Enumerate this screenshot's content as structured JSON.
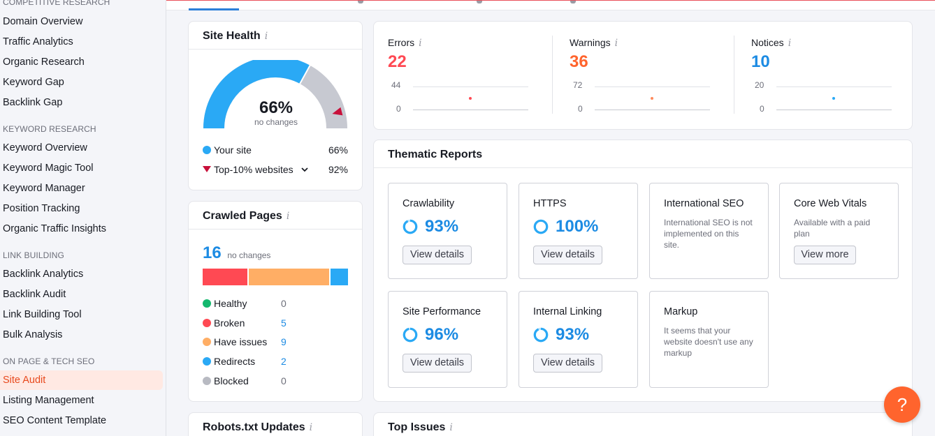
{
  "sidebar": {
    "sections": [
      {
        "label": "COMPETITIVE RESEARCH",
        "items": [
          "Domain Overview",
          "Traffic Analytics",
          "Organic Research",
          "Keyword Gap",
          "Backlink Gap"
        ]
      },
      {
        "label": "KEYWORD RESEARCH",
        "items": [
          "Keyword Overview",
          "Keyword Magic Tool",
          "Keyword Manager",
          "Position Tracking",
          "Organic Traffic Insights"
        ]
      },
      {
        "label": "LINK BUILDING",
        "items": [
          "Backlink Analytics",
          "Backlink Audit",
          "Link Building Tool",
          "Bulk Analysis"
        ]
      },
      {
        "label": "ON PAGE & TECH SEO",
        "items": [
          "Site Audit",
          "Listing Management",
          "SEO Content Template"
        ]
      }
    ],
    "active_item": "Site Audit"
  },
  "site_health": {
    "title": "Site Health",
    "info": "i",
    "percent": "66%",
    "percent_value": 66,
    "top10_marker_value": 92,
    "sub": "no changes",
    "legend": [
      {
        "label": "Your site",
        "value": "66%",
        "color": "#2aa9f5"
      },
      {
        "label": "Top-10% websites",
        "value": "92%",
        "color": "#c8103a"
      }
    ]
  },
  "crawled_pages": {
    "title": "Crawled Pages",
    "info": "i",
    "count": "16",
    "sub": "no changes",
    "rows": [
      {
        "label": "Healthy",
        "value": "0",
        "color": "#14b86e",
        "count": 0
      },
      {
        "label": "Broken",
        "value": "5",
        "color": "#ff4953",
        "count": 5
      },
      {
        "label": "Have issues",
        "value": "9",
        "color": "#ffae65",
        "count": 9
      },
      {
        "label": "Redirects",
        "value": "2",
        "color": "#2aa9f5",
        "count": 2
      },
      {
        "label": "Blocked",
        "value": "0",
        "color": "#b8bac2",
        "count": 0
      }
    ]
  },
  "issues": [
    {
      "label": "Errors",
      "info": "i",
      "value": "22",
      "color": "#ff4953",
      "tick_top": "44",
      "tick_bottom": "0"
    },
    {
      "label": "Warnings",
      "info": "i",
      "value": "36",
      "color": "#ff642d",
      "tick_top": "72",
      "tick_bottom": "0"
    },
    {
      "label": "Notices",
      "info": "i",
      "value": "10",
      "color": "#1c8be3",
      "tick_top": "20",
      "tick_bottom": "0"
    }
  ],
  "thematic": {
    "title": "Thematic Reports",
    "tiles": [
      {
        "title": "Crawlability",
        "pct": "93%",
        "value": 93,
        "button": "View details"
      },
      {
        "title": "HTTPS",
        "pct": "100%",
        "value": 100,
        "button": "View details"
      },
      {
        "title": "International SEO",
        "note": "International SEO is not implemented on this site."
      },
      {
        "title": "Core Web Vitals",
        "note": "Available with a paid plan",
        "button": "View more"
      },
      {
        "title": "Site Performance",
        "pct": "96%",
        "value": 96,
        "button": "View details"
      },
      {
        "title": "Internal Linking",
        "pct": "93%",
        "value": 93,
        "button": "View details"
      },
      {
        "title": "Markup",
        "note": "It seems that your website doesn't use any markup"
      }
    ]
  },
  "robots": {
    "title": "Robots.txt Updates",
    "info": "i"
  },
  "top_issues": {
    "title": "Top Issues",
    "info": "i"
  },
  "help": {
    "label": "?"
  }
}
